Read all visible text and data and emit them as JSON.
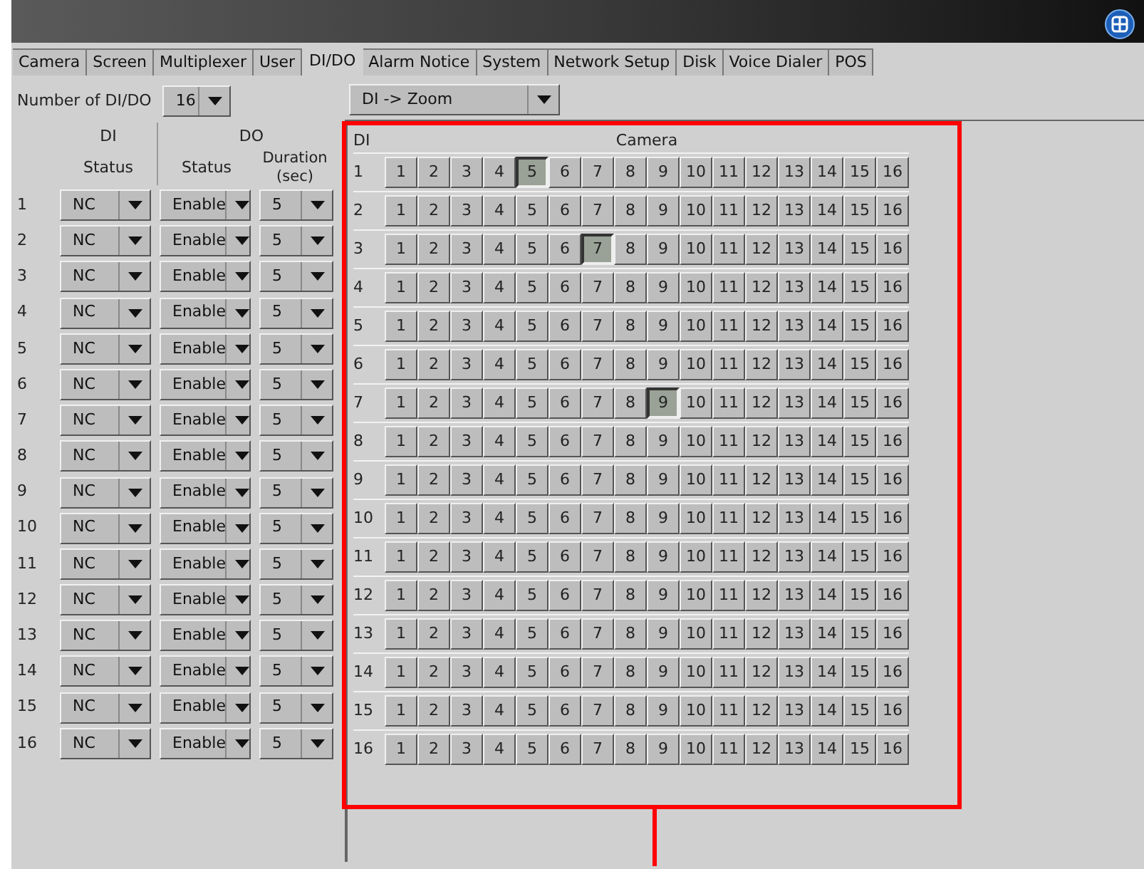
{
  "tabs": [
    {
      "label": "Camera",
      "selected": false
    },
    {
      "label": "Screen",
      "selected": false
    },
    {
      "label": "Multiplexer",
      "selected": false
    },
    {
      "label": "User",
      "selected": false
    },
    {
      "label": "DI/DO",
      "selected": true
    },
    {
      "label": "Alarm Notice",
      "selected": false
    },
    {
      "label": "System",
      "selected": false
    },
    {
      "label": "Network Setup",
      "selected": false
    },
    {
      "label": "Disk",
      "selected": false
    },
    {
      "label": "Voice Dialer",
      "selected": false
    },
    {
      "label": "POS",
      "selected": false
    }
  ],
  "number_of_dido": {
    "label": "Number of DI/DO",
    "value": "16"
  },
  "io_table": {
    "di_header": "DI",
    "di_status_header": "Status",
    "do_header": "DO",
    "do_status_header": "Status",
    "duration_header": "Duration (sec)",
    "rows": [
      {
        "index": "1",
        "di_status": "NC",
        "do_status": "Enable",
        "duration": "5"
      },
      {
        "index": "2",
        "di_status": "NC",
        "do_status": "Enable",
        "duration": "5"
      },
      {
        "index": "3",
        "di_status": "NC",
        "do_status": "Enable",
        "duration": "5"
      },
      {
        "index": "4",
        "di_status": "NC",
        "do_status": "Enable",
        "duration": "5"
      },
      {
        "index": "5",
        "di_status": "NC",
        "do_status": "Enable",
        "duration": "5"
      },
      {
        "index": "6",
        "di_status": "NC",
        "do_status": "Enable",
        "duration": "5"
      },
      {
        "index": "7",
        "di_status": "NC",
        "do_status": "Enable",
        "duration": "5"
      },
      {
        "index": "8",
        "di_status": "NC",
        "do_status": "Enable",
        "duration": "5"
      },
      {
        "index": "9",
        "di_status": "NC",
        "do_status": "Enable",
        "duration": "5"
      },
      {
        "index": "10",
        "di_status": "NC",
        "do_status": "Enable",
        "duration": "5"
      },
      {
        "index": "11",
        "di_status": "NC",
        "do_status": "Enable",
        "duration": "5"
      },
      {
        "index": "12",
        "di_status": "NC",
        "do_status": "Enable",
        "duration": "5"
      },
      {
        "index": "13",
        "di_status": "NC",
        "do_status": "Enable",
        "duration": "5"
      },
      {
        "index": "14",
        "di_status": "NC",
        "do_status": "Enable",
        "duration": "5"
      },
      {
        "index": "15",
        "di_status": "NC",
        "do_status": "Enable",
        "duration": "5"
      },
      {
        "index": "16",
        "di_status": "NC",
        "do_status": "Enable",
        "duration": "5"
      }
    ]
  },
  "mapping": {
    "mode": "DI -> Zoom",
    "di_header": "DI",
    "camera_header": "Camera",
    "rows": [
      {
        "label": "1",
        "cameras": [
          {
            "label": "1",
            "selected": false
          },
          {
            "label": "2",
            "selected": false
          },
          {
            "label": "3",
            "selected": false
          },
          {
            "label": "4",
            "selected": false
          },
          {
            "label": "5",
            "selected": true
          },
          {
            "label": "6",
            "selected": false
          },
          {
            "label": "7",
            "selected": false
          },
          {
            "label": "8",
            "selected": false
          },
          {
            "label": "9",
            "selected": false
          },
          {
            "label": "10",
            "selected": false
          },
          {
            "label": "11",
            "selected": false
          },
          {
            "label": "12",
            "selected": false
          },
          {
            "label": "13",
            "selected": false
          },
          {
            "label": "14",
            "selected": false
          },
          {
            "label": "15",
            "selected": false
          },
          {
            "label": "16",
            "selected": false
          }
        ]
      },
      {
        "label": "2",
        "cameras": [
          {
            "label": "1",
            "selected": false
          },
          {
            "label": "2",
            "selected": false
          },
          {
            "label": "3",
            "selected": false
          },
          {
            "label": "4",
            "selected": false
          },
          {
            "label": "5",
            "selected": false
          },
          {
            "label": "6",
            "selected": false
          },
          {
            "label": "7",
            "selected": false
          },
          {
            "label": "8",
            "selected": false
          },
          {
            "label": "9",
            "selected": false
          },
          {
            "label": "10",
            "selected": false
          },
          {
            "label": "11",
            "selected": false
          },
          {
            "label": "12",
            "selected": false
          },
          {
            "label": "13",
            "selected": false
          },
          {
            "label": "14",
            "selected": false
          },
          {
            "label": "15",
            "selected": false
          },
          {
            "label": "16",
            "selected": false
          }
        ]
      },
      {
        "label": "3",
        "cameras": [
          {
            "label": "1",
            "selected": false
          },
          {
            "label": "2",
            "selected": false
          },
          {
            "label": "3",
            "selected": false
          },
          {
            "label": "4",
            "selected": false
          },
          {
            "label": "5",
            "selected": false
          },
          {
            "label": "6",
            "selected": false
          },
          {
            "label": "7",
            "selected": true
          },
          {
            "label": "8",
            "selected": false
          },
          {
            "label": "9",
            "selected": false
          },
          {
            "label": "10",
            "selected": false
          },
          {
            "label": "11",
            "selected": false
          },
          {
            "label": "12",
            "selected": false
          },
          {
            "label": "13",
            "selected": false
          },
          {
            "label": "14",
            "selected": false
          },
          {
            "label": "15",
            "selected": false
          },
          {
            "label": "16",
            "selected": false
          }
        ]
      },
      {
        "label": "4",
        "cameras": [
          {
            "label": "1",
            "selected": false
          },
          {
            "label": "2",
            "selected": false
          },
          {
            "label": "3",
            "selected": false
          },
          {
            "label": "4",
            "selected": false
          },
          {
            "label": "5",
            "selected": false
          },
          {
            "label": "6",
            "selected": false
          },
          {
            "label": "7",
            "selected": false
          },
          {
            "label": "8",
            "selected": false
          },
          {
            "label": "9",
            "selected": false
          },
          {
            "label": "10",
            "selected": false
          },
          {
            "label": "11",
            "selected": false
          },
          {
            "label": "12",
            "selected": false
          },
          {
            "label": "13",
            "selected": false
          },
          {
            "label": "14",
            "selected": false
          },
          {
            "label": "15",
            "selected": false
          },
          {
            "label": "16",
            "selected": false
          }
        ]
      },
      {
        "label": "5",
        "cameras": [
          {
            "label": "1",
            "selected": false
          },
          {
            "label": "2",
            "selected": false
          },
          {
            "label": "3",
            "selected": false
          },
          {
            "label": "4",
            "selected": false
          },
          {
            "label": "5",
            "selected": false
          },
          {
            "label": "6",
            "selected": false
          },
          {
            "label": "7",
            "selected": false
          },
          {
            "label": "8",
            "selected": false
          },
          {
            "label": "9",
            "selected": false
          },
          {
            "label": "10",
            "selected": false
          },
          {
            "label": "11",
            "selected": false
          },
          {
            "label": "12",
            "selected": false
          },
          {
            "label": "13",
            "selected": false
          },
          {
            "label": "14",
            "selected": false
          },
          {
            "label": "15",
            "selected": false
          },
          {
            "label": "16",
            "selected": false
          }
        ]
      },
      {
        "label": "6",
        "cameras": [
          {
            "label": "1",
            "selected": false
          },
          {
            "label": "2",
            "selected": false
          },
          {
            "label": "3",
            "selected": false
          },
          {
            "label": "4",
            "selected": false
          },
          {
            "label": "5",
            "selected": false
          },
          {
            "label": "6",
            "selected": false
          },
          {
            "label": "7",
            "selected": false
          },
          {
            "label": "8",
            "selected": false
          },
          {
            "label": "9",
            "selected": false
          },
          {
            "label": "10",
            "selected": false
          },
          {
            "label": "11",
            "selected": false
          },
          {
            "label": "12",
            "selected": false
          },
          {
            "label": "13",
            "selected": false
          },
          {
            "label": "14",
            "selected": false
          },
          {
            "label": "15",
            "selected": false
          },
          {
            "label": "16",
            "selected": false
          }
        ]
      },
      {
        "label": "7",
        "cameras": [
          {
            "label": "1",
            "selected": false
          },
          {
            "label": "2",
            "selected": false
          },
          {
            "label": "3",
            "selected": false
          },
          {
            "label": "4",
            "selected": false
          },
          {
            "label": "5",
            "selected": false
          },
          {
            "label": "6",
            "selected": false
          },
          {
            "label": "7",
            "selected": false
          },
          {
            "label": "8",
            "selected": false
          },
          {
            "label": "9",
            "selected": true
          },
          {
            "label": "10",
            "selected": false
          },
          {
            "label": "11",
            "selected": false
          },
          {
            "label": "12",
            "selected": false
          },
          {
            "label": "13",
            "selected": false
          },
          {
            "label": "14",
            "selected": false
          },
          {
            "label": "15",
            "selected": false
          },
          {
            "label": "16",
            "selected": false
          }
        ]
      },
      {
        "label": "8",
        "cameras": [
          {
            "label": "1",
            "selected": false
          },
          {
            "label": "2",
            "selected": false
          },
          {
            "label": "3",
            "selected": false
          },
          {
            "label": "4",
            "selected": false
          },
          {
            "label": "5",
            "selected": false
          },
          {
            "label": "6",
            "selected": false
          },
          {
            "label": "7",
            "selected": false
          },
          {
            "label": "8",
            "selected": false
          },
          {
            "label": "9",
            "selected": false
          },
          {
            "label": "10",
            "selected": false
          },
          {
            "label": "11",
            "selected": false
          },
          {
            "label": "12",
            "selected": false
          },
          {
            "label": "13",
            "selected": false
          },
          {
            "label": "14",
            "selected": false
          },
          {
            "label": "15",
            "selected": false
          },
          {
            "label": "16",
            "selected": false
          }
        ]
      },
      {
        "label": "9",
        "cameras": [
          {
            "label": "1",
            "selected": false
          },
          {
            "label": "2",
            "selected": false
          },
          {
            "label": "3",
            "selected": false
          },
          {
            "label": "4",
            "selected": false
          },
          {
            "label": "5",
            "selected": false
          },
          {
            "label": "6",
            "selected": false
          },
          {
            "label": "7",
            "selected": false
          },
          {
            "label": "8",
            "selected": false
          },
          {
            "label": "9",
            "selected": false
          },
          {
            "label": "10",
            "selected": false
          },
          {
            "label": "11",
            "selected": false
          },
          {
            "label": "12",
            "selected": false
          },
          {
            "label": "13",
            "selected": false
          },
          {
            "label": "14",
            "selected": false
          },
          {
            "label": "15",
            "selected": false
          },
          {
            "label": "16",
            "selected": false
          }
        ]
      },
      {
        "label": "10",
        "cameras": [
          {
            "label": "1",
            "selected": false
          },
          {
            "label": "2",
            "selected": false
          },
          {
            "label": "3",
            "selected": false
          },
          {
            "label": "4",
            "selected": false
          },
          {
            "label": "5",
            "selected": false
          },
          {
            "label": "6",
            "selected": false
          },
          {
            "label": "7",
            "selected": false
          },
          {
            "label": "8",
            "selected": false
          },
          {
            "label": "9",
            "selected": false
          },
          {
            "label": "10",
            "selected": false
          },
          {
            "label": "11",
            "selected": false
          },
          {
            "label": "12",
            "selected": false
          },
          {
            "label": "13",
            "selected": false
          },
          {
            "label": "14",
            "selected": false
          },
          {
            "label": "15",
            "selected": false
          },
          {
            "label": "16",
            "selected": false
          }
        ]
      },
      {
        "label": "11",
        "cameras": [
          {
            "label": "1",
            "selected": false
          },
          {
            "label": "2",
            "selected": false
          },
          {
            "label": "3",
            "selected": false
          },
          {
            "label": "4",
            "selected": false
          },
          {
            "label": "5",
            "selected": false
          },
          {
            "label": "6",
            "selected": false
          },
          {
            "label": "7",
            "selected": false
          },
          {
            "label": "8",
            "selected": false
          },
          {
            "label": "9",
            "selected": false
          },
          {
            "label": "10",
            "selected": false
          },
          {
            "label": "11",
            "selected": false
          },
          {
            "label": "12",
            "selected": false
          },
          {
            "label": "13",
            "selected": false
          },
          {
            "label": "14",
            "selected": false
          },
          {
            "label": "15",
            "selected": false
          },
          {
            "label": "16",
            "selected": false
          }
        ]
      },
      {
        "label": "12",
        "cameras": [
          {
            "label": "1",
            "selected": false
          },
          {
            "label": "2",
            "selected": false
          },
          {
            "label": "3",
            "selected": false
          },
          {
            "label": "4",
            "selected": false
          },
          {
            "label": "5",
            "selected": false
          },
          {
            "label": "6",
            "selected": false
          },
          {
            "label": "7",
            "selected": false
          },
          {
            "label": "8",
            "selected": false
          },
          {
            "label": "9",
            "selected": false
          },
          {
            "label": "10",
            "selected": false
          },
          {
            "label": "11",
            "selected": false
          },
          {
            "label": "12",
            "selected": false
          },
          {
            "label": "13",
            "selected": false
          },
          {
            "label": "14",
            "selected": false
          },
          {
            "label": "15",
            "selected": false
          },
          {
            "label": "16",
            "selected": false
          }
        ]
      },
      {
        "label": "13",
        "cameras": [
          {
            "label": "1",
            "selected": false
          },
          {
            "label": "2",
            "selected": false
          },
          {
            "label": "3",
            "selected": false
          },
          {
            "label": "4",
            "selected": false
          },
          {
            "label": "5",
            "selected": false
          },
          {
            "label": "6",
            "selected": false
          },
          {
            "label": "7",
            "selected": false
          },
          {
            "label": "8",
            "selected": false
          },
          {
            "label": "9",
            "selected": false
          },
          {
            "label": "10",
            "selected": false
          },
          {
            "label": "11",
            "selected": false
          },
          {
            "label": "12",
            "selected": false
          },
          {
            "label": "13",
            "selected": false
          },
          {
            "label": "14",
            "selected": false
          },
          {
            "label": "15",
            "selected": false
          },
          {
            "label": "16",
            "selected": false
          }
        ]
      },
      {
        "label": "14",
        "cameras": [
          {
            "label": "1",
            "selected": false
          },
          {
            "label": "2",
            "selected": false
          },
          {
            "label": "3",
            "selected": false
          },
          {
            "label": "4",
            "selected": false
          },
          {
            "label": "5",
            "selected": false
          },
          {
            "label": "6",
            "selected": false
          },
          {
            "label": "7",
            "selected": false
          },
          {
            "label": "8",
            "selected": false
          },
          {
            "label": "9",
            "selected": false
          },
          {
            "label": "10",
            "selected": false
          },
          {
            "label": "11",
            "selected": false
          },
          {
            "label": "12",
            "selected": false
          },
          {
            "label": "13",
            "selected": false
          },
          {
            "label": "14",
            "selected": false
          },
          {
            "label": "15",
            "selected": false
          },
          {
            "label": "16",
            "selected": false
          }
        ]
      },
      {
        "label": "15",
        "cameras": [
          {
            "label": "1",
            "selected": false
          },
          {
            "label": "2",
            "selected": false
          },
          {
            "label": "3",
            "selected": false
          },
          {
            "label": "4",
            "selected": false
          },
          {
            "label": "5",
            "selected": false
          },
          {
            "label": "6",
            "selected": false
          },
          {
            "label": "7",
            "selected": false
          },
          {
            "label": "8",
            "selected": false
          },
          {
            "label": "9",
            "selected": false
          },
          {
            "label": "10",
            "selected": false
          },
          {
            "label": "11",
            "selected": false
          },
          {
            "label": "12",
            "selected": false
          },
          {
            "label": "13",
            "selected": false
          },
          {
            "label": "14",
            "selected": false
          },
          {
            "label": "15",
            "selected": false
          },
          {
            "label": "16",
            "selected": false
          }
        ]
      },
      {
        "label": "16",
        "cameras": [
          {
            "label": "1",
            "selected": false
          },
          {
            "label": "2",
            "selected": false
          },
          {
            "label": "3",
            "selected": false
          },
          {
            "label": "4",
            "selected": false
          },
          {
            "label": "5",
            "selected": false
          },
          {
            "label": "6",
            "selected": false
          },
          {
            "label": "7",
            "selected": false
          },
          {
            "label": "8",
            "selected": false
          },
          {
            "label": "9",
            "selected": false
          },
          {
            "label": "10",
            "selected": false
          },
          {
            "label": "11",
            "selected": false
          },
          {
            "label": "12",
            "selected": false
          },
          {
            "label": "13",
            "selected": false
          },
          {
            "label": "14",
            "selected": false
          },
          {
            "label": "15",
            "selected": false
          },
          {
            "label": "16",
            "selected": false
          }
        ]
      }
    ]
  }
}
